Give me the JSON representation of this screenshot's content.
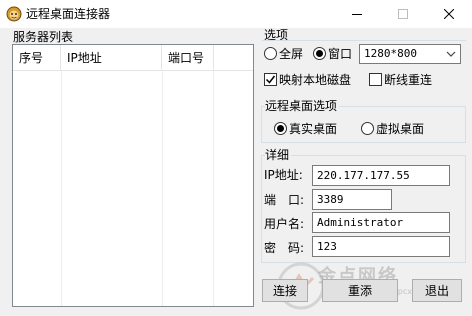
{
  "window": {
    "title": "远程桌面连接器",
    "app_icon": "cartoon-face-icon",
    "controls": [
      "minimize-icon",
      "maximize-icon",
      "close-icon"
    ]
  },
  "server_list": {
    "label": "服务器列表",
    "columns": [
      "序号",
      "IP地址",
      "端口号"
    ],
    "rows": []
  },
  "options": {
    "title": "选项",
    "fullscreen_label": "全屏",
    "window_label": "窗口",
    "mode_selected": "window",
    "resolution": "1280*800",
    "map_disk_label": "映射本地磁盘",
    "map_disk_checked": true,
    "reconnect_label": "断线重连",
    "reconnect_checked": false
  },
  "desktop_options": {
    "title": "远程桌面选项",
    "real_label": "真实桌面",
    "virtual_label": "虚拟桌面",
    "selected": "real"
  },
  "details": {
    "title": "详细",
    "ip_label": "IP地址:",
    "ip_value": "220.177.177.55",
    "port_label": "端　口:",
    "port_value": "3389",
    "user_label": "用户名:",
    "user_value": "Administrator",
    "password_label": "密　码:",
    "password_value": "123"
  },
  "buttons": {
    "connect": "连接",
    "add": "重添",
    "exit": "退出"
  },
  "watermark": {
    "text": "金点网络",
    "url": "http://jdpcxh.com"
  }
}
